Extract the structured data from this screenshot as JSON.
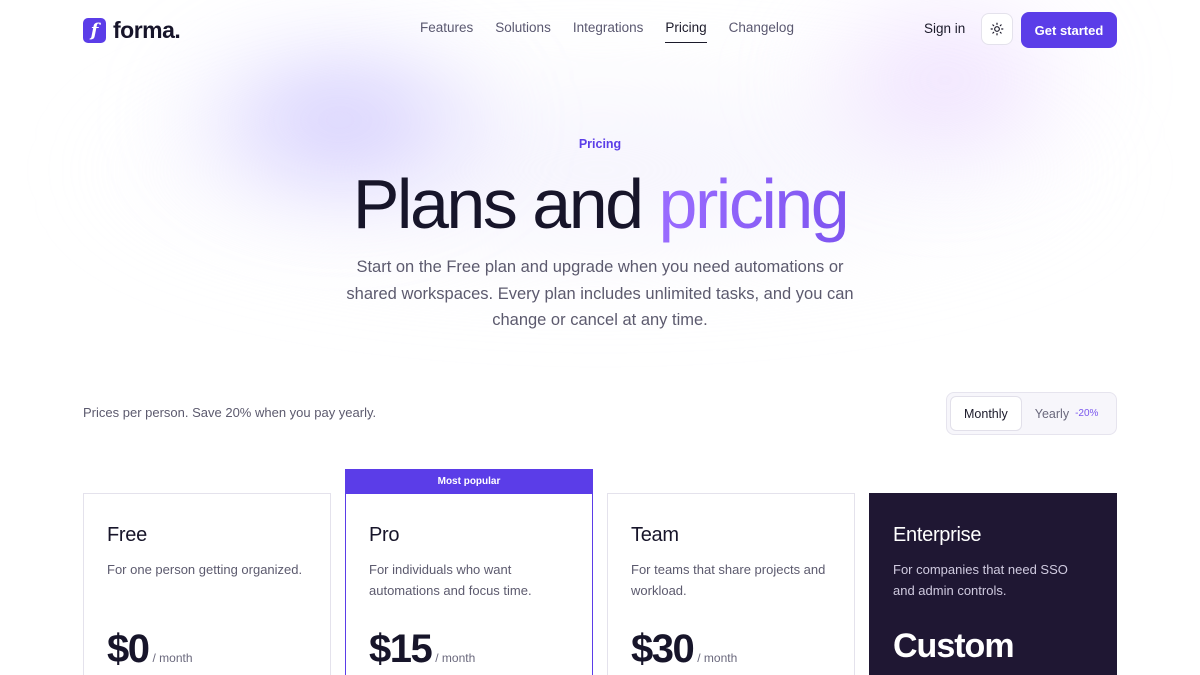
{
  "brand": {
    "logo_letter": "f",
    "name": "forma.",
    "accent_color": "#5b3de8"
  },
  "nav": {
    "links": [
      {
        "label": "Features"
      },
      {
        "label": "Solutions"
      },
      {
        "label": "Integrations"
      },
      {
        "label": "Pricing",
        "active": true
      },
      {
        "label": "Changelog"
      }
    ],
    "sign_in": "Sign in",
    "theme_icon": "sun-icon",
    "cta": "Get started"
  },
  "hero": {
    "eyebrow": "Pricing",
    "title_main": "Plans and",
    "title_accent": "pricing",
    "subtitle": "Start on the Free plan and upgrade when you need automations or shared workspaces. Every plan includes unlimited tasks, and you can change or cancel at any time."
  },
  "billing": {
    "note": "Prices per person. Save 20% when you pay yearly.",
    "options": [
      {
        "label": "Monthly",
        "selected": true
      },
      {
        "label": "Yearly",
        "badge": "-20%"
      }
    ]
  },
  "plans": [
    {
      "name": "Free",
      "description": "For one person getting organized.",
      "price": "$0",
      "period": "/ month"
    },
    {
      "name": "Pro",
      "description": "For individuals who want automations and focus time.",
      "price": "$15",
      "period": "/ month",
      "badge": "Most popular"
    },
    {
      "name": "Team",
      "description": "For teams that share projects and workload.",
      "price": "$30",
      "period": "/ month"
    },
    {
      "name": "Enterprise",
      "description": "For companies that need SSO and admin controls.",
      "price": "Custom"
    }
  ]
}
